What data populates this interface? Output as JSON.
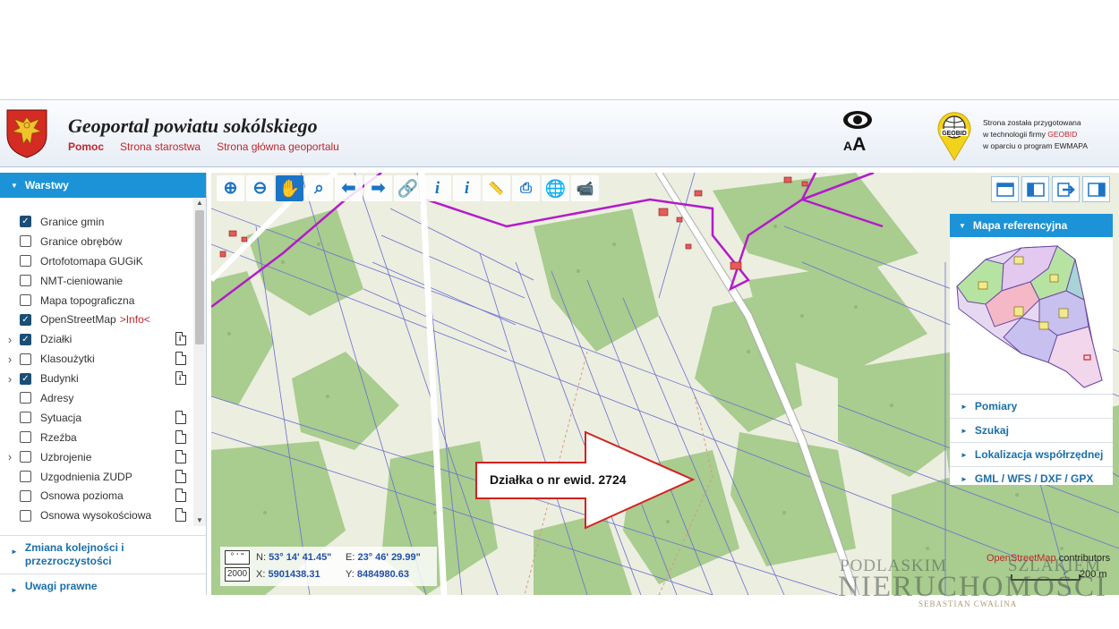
{
  "header": {
    "title": "Geoportal powiatu sokólskiego",
    "links": [
      "Pomoc",
      "Strona starostwa",
      "Strona główna geoportalu"
    ],
    "accessibility_label": "AA",
    "accessibility_small": "A",
    "accessibility_big": "A",
    "geobid_logo_text": "GEOBID",
    "info_line1": "Strona została przygotowana",
    "info_line2_prefix": "w technologii firmy ",
    "info_line2_brand": "GEOBID",
    "info_line3": "w oparciu o program EWMAPA"
  },
  "sidebar": {
    "layers_title": "Warstwy",
    "layers": [
      {
        "label": "Granice gmin",
        "checked": true,
        "expandable": false,
        "doc": ""
      },
      {
        "label": "Granice obrębów",
        "checked": false,
        "expandable": false,
        "doc": ""
      },
      {
        "label": "Ortofotomapa GUGiK",
        "checked": false,
        "expandable": false,
        "doc": ""
      },
      {
        "label": "NMT-cieniowanie",
        "checked": false,
        "expandable": false,
        "doc": ""
      },
      {
        "label": "Mapa topograficzna",
        "checked": false,
        "expandable": false,
        "doc": ""
      },
      {
        "label": "OpenStreetMap",
        "info": ">Info<",
        "checked": true,
        "expandable": false,
        "doc": ""
      },
      {
        "label": "Działki",
        "checked": true,
        "expandable": true,
        "doc": "info"
      },
      {
        "label": "Klasoużytki",
        "checked": false,
        "expandable": true,
        "doc": "plain"
      },
      {
        "label": "Budynki",
        "checked": true,
        "expandable": true,
        "doc": "info"
      },
      {
        "label": "Adresy",
        "checked": false,
        "expandable": false,
        "doc": ""
      },
      {
        "label": "Sytuacja",
        "checked": false,
        "expandable": false,
        "doc": "plain"
      },
      {
        "label": "Rzeźba",
        "checked": false,
        "expandable": false,
        "doc": "plain"
      },
      {
        "label": "Uzbrojenie",
        "checked": false,
        "expandable": true,
        "doc": "plain"
      },
      {
        "label": "Uzgodnienia ZUDP",
        "checked": false,
        "expandable": false,
        "doc": "plain"
      },
      {
        "label": "Osnowa pozioma",
        "checked": false,
        "expandable": false,
        "doc": "plain"
      },
      {
        "label": "Osnowa wysokościowa",
        "checked": false,
        "expandable": false,
        "doc": "plain"
      }
    ],
    "order_label": "Zmiana kolejności i przezroczystości",
    "legal_label": "Uwagi prawne"
  },
  "toolbar": {
    "icons": [
      "zoom-in-icon",
      "zoom-out-icon",
      "pan-hand-icon",
      "zoom-rect-icon",
      "back-arrow-icon",
      "forward-arrow-icon",
      "link-icon",
      "info-icon",
      "info-edit-icon",
      "ruler-icon",
      "print-icon",
      "globe-icon",
      "camera-icon"
    ]
  },
  "view_buttons": [
    "layout-top-icon",
    "layout-left-icon",
    "export-icon",
    "layout-right-icon"
  ],
  "ref_panel": {
    "title": "Mapa referencyjna",
    "items": [
      "Pomiary",
      "Szukaj",
      "Lokalizacja współrzędnej",
      "GML / WFS / DXF / GPX"
    ]
  },
  "coords": {
    "format_btn": "° ' \"",
    "scale_btn": "2000",
    "n_label": "N:",
    "n_value": "53° 14' 41.45\"",
    "e_label": "E:",
    "e_value": "23° 46' 29.99\"",
    "x_label": "X:",
    "x_value": "5901438.31",
    "y_label": "Y:",
    "y_value": "8484980.63"
  },
  "callout": {
    "text": "Działka o nr ewid. 2724"
  },
  "attribution": {
    "osm": "OpenStreetMap",
    "rest": " contributors"
  },
  "scale_bar": {
    "label": "200 m"
  },
  "watermark": {
    "line1a": "PODLASKIM",
    "line1b": "SZLAKIEM",
    "line2": "NIERUCHOMOŚCI",
    "line3": "SEBASTIAN CWALINA"
  },
  "colors": {
    "accent": "#1b93d6",
    "link_red": "#c0262c",
    "forest": "#a9cc8f",
    "field": "#eceee0"
  }
}
